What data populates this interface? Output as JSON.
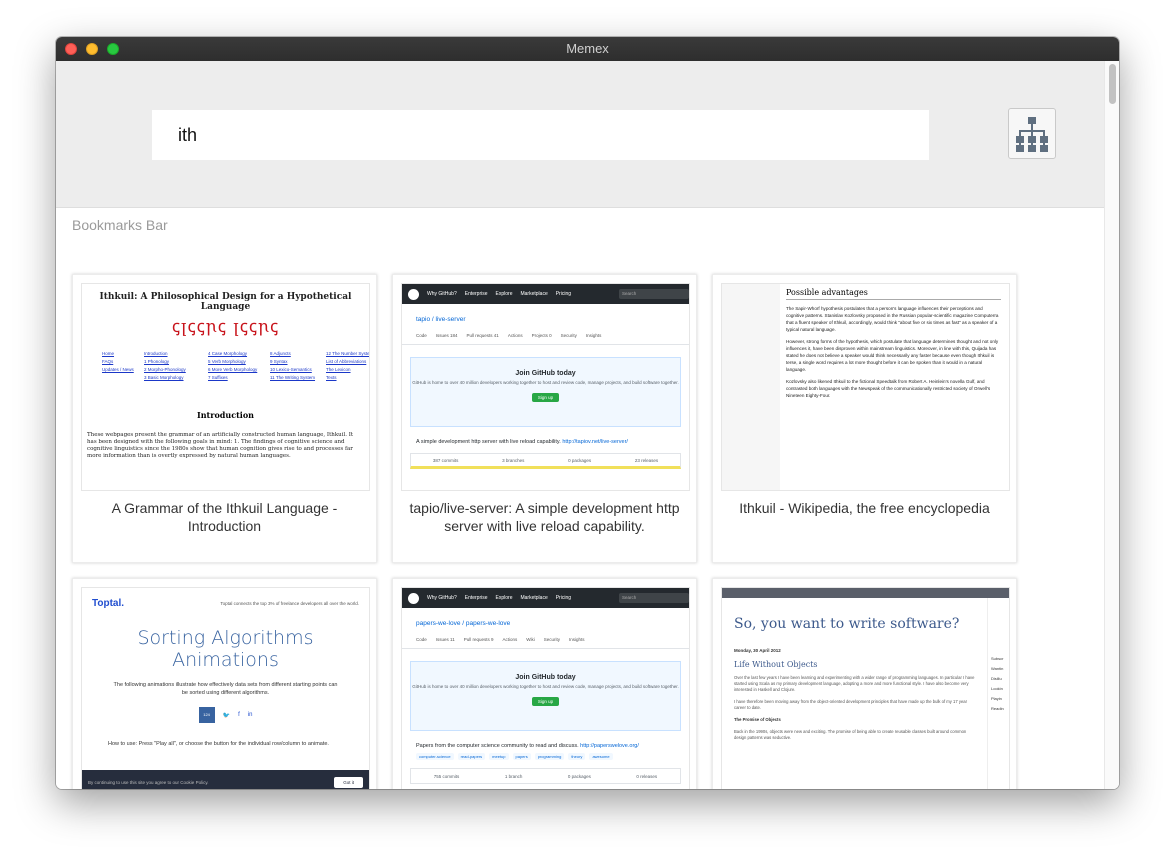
{
  "window": {
    "title": "Memex"
  },
  "search": {
    "value": "ith",
    "placeholder": ""
  },
  "toolbar": {
    "tree_icon": "sitemap-icon"
  },
  "section": {
    "title": "Bookmarks Bar"
  },
  "bookmarks": [
    {
      "title": "A Grammar of the Ithkuil Language - Introduction"
    },
    {
      "title": "tapio/live-server: A simple development http server with live reload capability."
    },
    {
      "title": "Ithkuil - Wikipedia, the free encyclopedia"
    },
    {
      "title": ""
    },
    {
      "title": ""
    },
    {
      "title": ""
    }
  ],
  "thumbs": {
    "ithkuil": {
      "heading": "Ithkuil: A Philosophical Design for a Hypothetical Language",
      "script": "ꞔꞁꞔꞔꞃꞔ ꞁꞔꞔꞃꞔ",
      "links": [
        "Home",
        "Introduction",
        "4 Case Morphology",
        "8 Adjuncts",
        "12 The Number System",
        "FAQs",
        "1 Phonology",
        "5 Verb Morphology",
        "9 Syntax",
        "List of Abbreviations",
        "Updates / News",
        "2 Morpho-Phonology",
        "6 More Verb Morphology",
        "10 Lexico-Semantics",
        "The Lexicon",
        "",
        "3 Basic Morphology",
        "7 Suffixes",
        "11 The Writing System",
        "Texts"
      ],
      "intro": "Introduction",
      "text": "These webpages present the grammar of an artificially constructed human language, Ithkuil. It has been designed with the following goals in mind: 1. The findings of cognitive science and cognitive linguistics since the 1980s show that human cognition gives rise to and processes far more information than is overtly expressed by natural human languages."
    },
    "liveserver": {
      "nav": [
        "Why GitHub?",
        "Enterprise",
        "Explore",
        "Marketplace",
        "Pricing"
      ],
      "search": "Search",
      "repo": "tapio / live-server",
      "tabs": [
        "Code",
        "Issues 184",
        "Pull requests 41",
        "Actions",
        "Projects 0",
        "Security",
        "Insights"
      ],
      "join_title": "Join GitHub today",
      "join_text": "GitHub is home to over 40 million developers working together to host and review code, manage projects, and build software together.",
      "signup": "Sign up",
      "desc": "A simple development http server with live reload capability.",
      "link": "http://tapiov.net/live-server/",
      "stats": [
        "387 commits",
        "3 branches",
        "0 packages",
        "23 releases"
      ]
    },
    "wiki": {
      "heading": "Possible advantages",
      "p1": "The Sapir-Whorf hypothesis postulates that a person's language influences their perceptions and cognitive patterns. Stanislav Kozlovsky proposed in the Russian popular-scientific magazine Computerra that a fluent speaker of Ithkuil, accordingly, would think \"about five or six times as fast\" as a speaker of a typical natural language.",
      "p2": "However, strong forms of the hypothesis, which postulate that language determines thought and not only influences it, have been disproven within mainstream linguistics. Moreover, in line with this, Quijada has stated he does not believe a speaker would think necessarily any faster because even though Ithkuil is terse, a single word requires a lot more thought before it can be spoken than it would in a natural language.",
      "p3": "Kozlovsky also likened Ithkuil to the fictional Speedtalk from Robert A. Heinlein's novella Gulf, and contrasted both languages with the Newspeak of the communicationally restricted society of Orwell's Nineteen Eighty-Four."
    },
    "toptal": {
      "logo": "Toptal.",
      "tagline": "Toptal connects the top 3% of freelance developers all over the world.",
      "title": "Sorting Algorithms Animations",
      "sub": "The following animations illustrate how effectively data sets from different starting points can be sorted using different algorithms.",
      "count": "124",
      "howto": "How to use: Press \"Play all\", or choose the button for the individual row/column to animate.",
      "cookie": "By continuing to use this site you agree to our Cookie Policy.",
      "gotit": "Got it"
    },
    "papers": {
      "nav": [
        "Why GitHub?",
        "Enterprise",
        "Explore",
        "Marketplace",
        "Pricing"
      ],
      "search": "Search",
      "repo": "papers-we-love / papers-we-love",
      "tabs": [
        "Code",
        "Issues 11",
        "Pull requests 9",
        "Actions",
        "Wiki",
        "Security",
        "Insights"
      ],
      "join_title": "Join GitHub today",
      "join_text": "GitHub is home to over 40 million developers working together to host and review code, manage projects, and build software together.",
      "signup": "Sign up",
      "desc": "Papers from the computer science community to read and discuss.",
      "link": "http://paperswelove.org/",
      "topics": [
        "computer-science",
        "read-papers",
        "meetup",
        "papers",
        "programming",
        "theory",
        "awesome"
      ],
      "stats": [
        "755 commits",
        "1 branch",
        "0 packages",
        "0 releases"
      ]
    },
    "blog": {
      "title": "So, you want to write software?",
      "date": "Monday, 30 April 2012",
      "subtitle": "Life Without Objects",
      "p1": "Over the last few years I have been learning and experimenting with a wider range of programming languages. In particular I have started using Scala as my primary development language, adopting a more and more functional style. I have also become very interested in Haskell and Clojure.",
      "p2": "I have therefore been moving away from the object-oriented development principles that have made up the bulk of my 17 year career to date.",
      "sub2": "The Promise of Objects",
      "p3": "Back in the 1990s, objects were new and exciting. The promise of being able to create reusable classes built around common design patterns was seductive.",
      "side": [
        "Subscr",
        "Wantin",
        "Disillu",
        "Lookin",
        "Playin",
        "Readin"
      ]
    }
  },
  "colors": {
    "accent": "#3863a0",
    "github_dark": "#24292e",
    "ithkuil_script": "#c8131b"
  }
}
